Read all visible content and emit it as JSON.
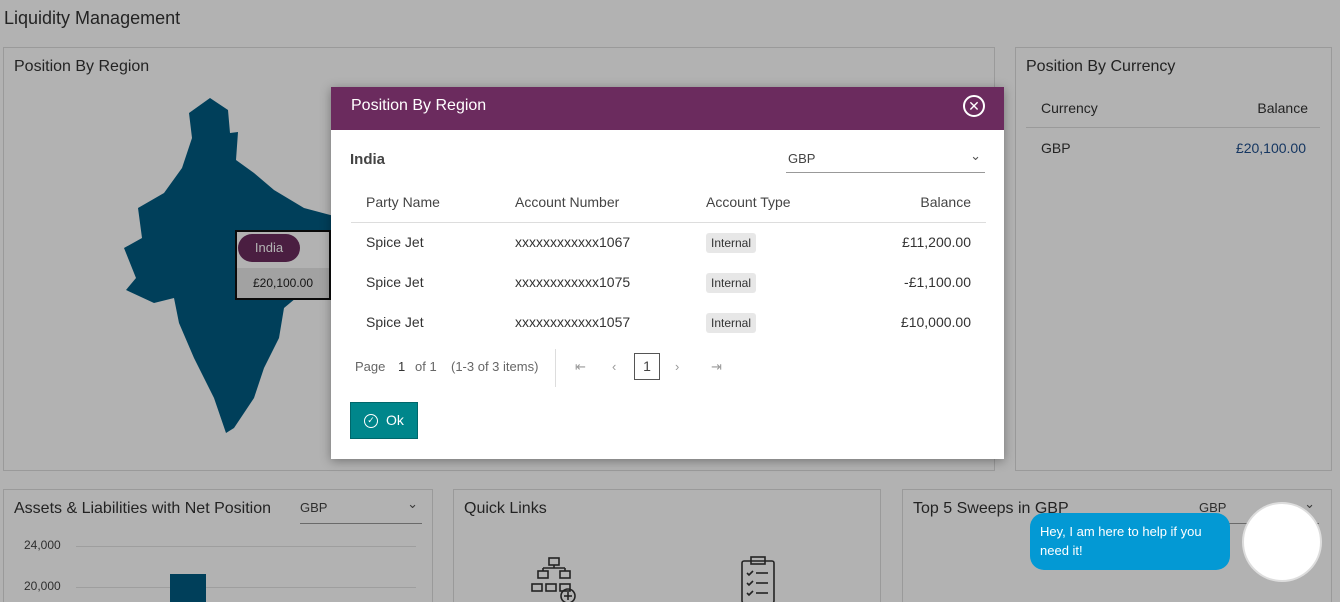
{
  "page": {
    "title": "Liquidity Management"
  },
  "region_card": {
    "title": "Position By Region",
    "tooltip": {
      "region": "India",
      "value": "£20,100.00"
    }
  },
  "currency_card": {
    "title": "Position By Currency",
    "headers": {
      "currency": "Currency",
      "balance": "Balance"
    },
    "rows": [
      {
        "currency": "GBP",
        "balance": "£20,100.00"
      }
    ]
  },
  "assets_card": {
    "title": "Assets & Liabilities with Net Position",
    "currency_select": "GBP",
    "y_ticks": [
      "24,000",
      "20,000"
    ]
  },
  "quick_links_card": {
    "title": "Quick Links"
  },
  "sweeps_card": {
    "title": "Top 5 Sweeps in GBP",
    "currency_select": "GBP"
  },
  "modal": {
    "title": "Position By Region",
    "region": "India",
    "currency_select": "GBP",
    "columns": {
      "party": "Party Name",
      "account": "Account Number",
      "type": "Account Type",
      "balance": "Balance"
    },
    "rows": [
      {
        "party": "Spice Jet",
        "account": "xxxxxxxxxxxx1067",
        "type": "Internal",
        "balance": "£11,200.00"
      },
      {
        "party": "Spice Jet",
        "account": "xxxxxxxxxxxx1075",
        "type": "Internal",
        "balance": "-£1,100.00"
      },
      {
        "party": "Spice Jet",
        "account": "xxxxxxxxxxxx1057",
        "type": "Internal",
        "balance": "£10,000.00"
      }
    ],
    "pager": {
      "page_label": "Page",
      "page": "1",
      "of_label": "of 1",
      "items": "(1-3 of 3 items)",
      "current": "1"
    },
    "ok_label": "Ok"
  },
  "chat": {
    "message": "Hey, I am here to help if you need it!"
  },
  "colors": {
    "header": "#6b2b5e",
    "map": "#005b82",
    "ok": "#00868b",
    "chat": "#0399d4"
  }
}
